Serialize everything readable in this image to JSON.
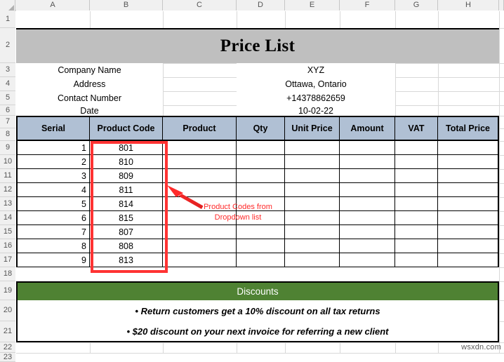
{
  "spreadsheet": {
    "column_headers": [
      "A",
      "B",
      "C",
      "D",
      "E",
      "F",
      "G",
      "H"
    ],
    "row_headers": [
      "1",
      "2",
      "3",
      "4",
      "5",
      "6",
      "7",
      "8",
      "9",
      "10",
      "11",
      "12",
      "13",
      "14",
      "15",
      "16",
      "17",
      "18",
      "19",
      "20",
      "21",
      "22",
      "23"
    ]
  },
  "document": {
    "title": "Price List",
    "info_rows": [
      {
        "label": "Company Name",
        "value": "XYZ"
      },
      {
        "label": "Address",
        "value": "Ottawa, Ontario"
      },
      {
        "label": "Contact Number",
        "value": "+14378862659"
      },
      {
        "label": "Date",
        "value": "10-02-22"
      }
    ],
    "table": {
      "headers": [
        "Serial",
        "Product Code",
        "Product",
        "Qty",
        "Unit Price",
        "Amount",
        "VAT",
        "Total Price"
      ],
      "rows": [
        {
          "serial": "1",
          "product_code": "801",
          "product": "",
          "qty": "",
          "unit_price": "",
          "amount": "",
          "vat": "",
          "total_price": ""
        },
        {
          "serial": "2",
          "product_code": "810",
          "product": "",
          "qty": "",
          "unit_price": "",
          "amount": "",
          "vat": "",
          "total_price": ""
        },
        {
          "serial": "3",
          "product_code": "809",
          "product": "",
          "qty": "",
          "unit_price": "",
          "amount": "",
          "vat": "",
          "total_price": ""
        },
        {
          "serial": "4",
          "product_code": "811",
          "product": "",
          "qty": "",
          "unit_price": "",
          "amount": "",
          "vat": "",
          "total_price": ""
        },
        {
          "serial": "5",
          "product_code": "814",
          "product": "",
          "qty": "",
          "unit_price": "",
          "amount": "",
          "vat": "",
          "total_price": ""
        },
        {
          "serial": "6",
          "product_code": "815",
          "product": "",
          "qty": "",
          "unit_price": "",
          "amount": "",
          "vat": "",
          "total_price": ""
        },
        {
          "serial": "7",
          "product_code": "807",
          "product": "",
          "qty": "",
          "unit_price": "",
          "amount": "",
          "vat": "",
          "total_price": ""
        },
        {
          "serial": "8",
          "product_code": "808",
          "product": "",
          "qty": "",
          "unit_price": "",
          "amount": "",
          "vat": "",
          "total_price": ""
        },
        {
          "serial": "9",
          "product_code": "813",
          "product": "",
          "qty": "",
          "unit_price": "",
          "amount": "",
          "vat": "",
          "total_price": ""
        }
      ]
    },
    "discounts": {
      "header": "Discounts",
      "lines": [
        "• Return customers get a 10% discount on all tax returns",
        "• $20 discount on your next invoice for referring a new client"
      ]
    }
  },
  "annotation": {
    "line1": "Product Codes from",
    "line2": "Dropdown list",
    "color": "#ff2a2a"
  },
  "watermark": "wsxdn.com",
  "colors": {
    "title_fill": "#bfbfbf",
    "table_header_fill": "#b0c0d4",
    "discount_fill": "#4f8233",
    "annotation_red": "#ff3333",
    "grid_line": "#d8d8d8",
    "header_strip": "#f0f0f0"
  }
}
